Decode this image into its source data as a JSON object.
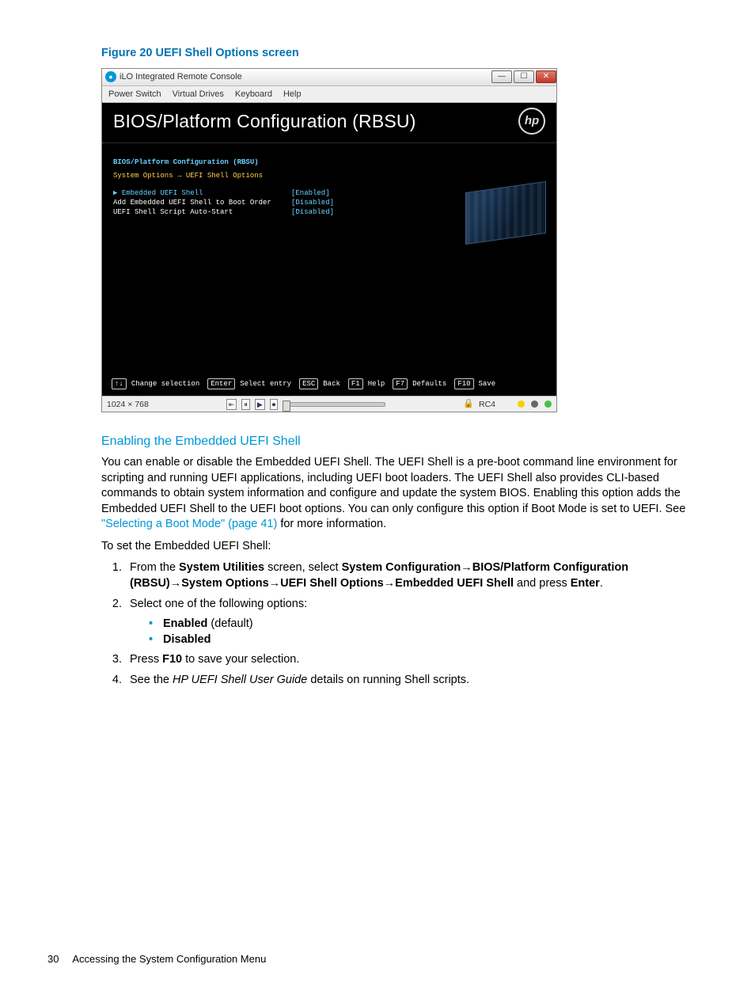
{
  "figure": {
    "caption": "Figure 20 UEFI Shell Options screen"
  },
  "window": {
    "title": "iLO Integrated Remote Console",
    "menu": [
      "Power Switch",
      "Virtual Drives",
      "Keyboard",
      "Help"
    ],
    "min": "—",
    "max": "☐",
    "close": "✕"
  },
  "bios": {
    "title": "BIOS/Platform Configuration (RBSU)",
    "logo": "hp",
    "crumb1": "BIOS/Platform Configuration (RBSU)",
    "crumb2": "System Options → UEFI Shell Options",
    "opts": [
      {
        "name": "Embedded UEFI Shell",
        "val": "[Enabled]",
        "sel": true
      },
      {
        "name": "Add Embedded UEFI Shell to Boot Order",
        "val": "[Disabled]",
        "sel": false
      },
      {
        "name": "UEFI Shell Script Auto-Start",
        "val": "[Disabled]",
        "sel": false
      }
    ],
    "keys": [
      {
        "k": "↑↓",
        "l": "Change selection"
      },
      {
        "k": "Enter",
        "l": "Select entry"
      },
      {
        "k": "ESC",
        "l": "Back"
      },
      {
        "k": "F1",
        "l": "Help"
      },
      {
        "k": "F7",
        "l": "Defaults"
      },
      {
        "k": "F10",
        "l": "Save"
      }
    ]
  },
  "status": {
    "res": "1024 × 768",
    "rc4": "RC4"
  },
  "section": {
    "heading": "Enabling the Embedded UEFI Shell",
    "para_pre": "You can enable or disable the Embedded UEFI Shell. The UEFI Shell is a pre-boot command line environment for scripting and running UEFI applications, including UEFI boot loaders. The UEFI Shell also provides CLI-based commands to obtain system information and configure and update the system BIOS. Enabling this option adds the Embedded UEFI Shell to the UEFI boot options. You can only configure this option if Boot Mode is set to UEFI. See ",
    "link": "\"Selecting a Boot Mode\" (page 41)",
    "para_post": " for more information.",
    "lead2": "To set the Embedded UEFI Shell:",
    "step1_a": "From the ",
    "step1_b": "System Utilities",
    "step1_c": " screen, select ",
    "step1_d": "System Configuration",
    "step1_e": "BIOS/Platform Configuration (RBSU)",
    "step1_f": "System Options",
    "step1_g": "UEFI Shell Options",
    "step1_h": "Embedded UEFI Shell",
    "step1_i": " and press ",
    "step1_j": "Enter",
    "step2": "Select one of the following options:",
    "opt_en": "Enabled",
    "opt_en_suffix": " (default)",
    "opt_dis": "Disabled",
    "step3_a": "Press ",
    "step3_b": "F10",
    "step3_c": " to save your selection.",
    "step4_a": "See the ",
    "step4_b": "HP UEFI Shell User Guide",
    "step4_c": " details on running Shell scripts."
  },
  "footer": {
    "page": "30",
    "title": "Accessing the System Configuration Menu"
  }
}
